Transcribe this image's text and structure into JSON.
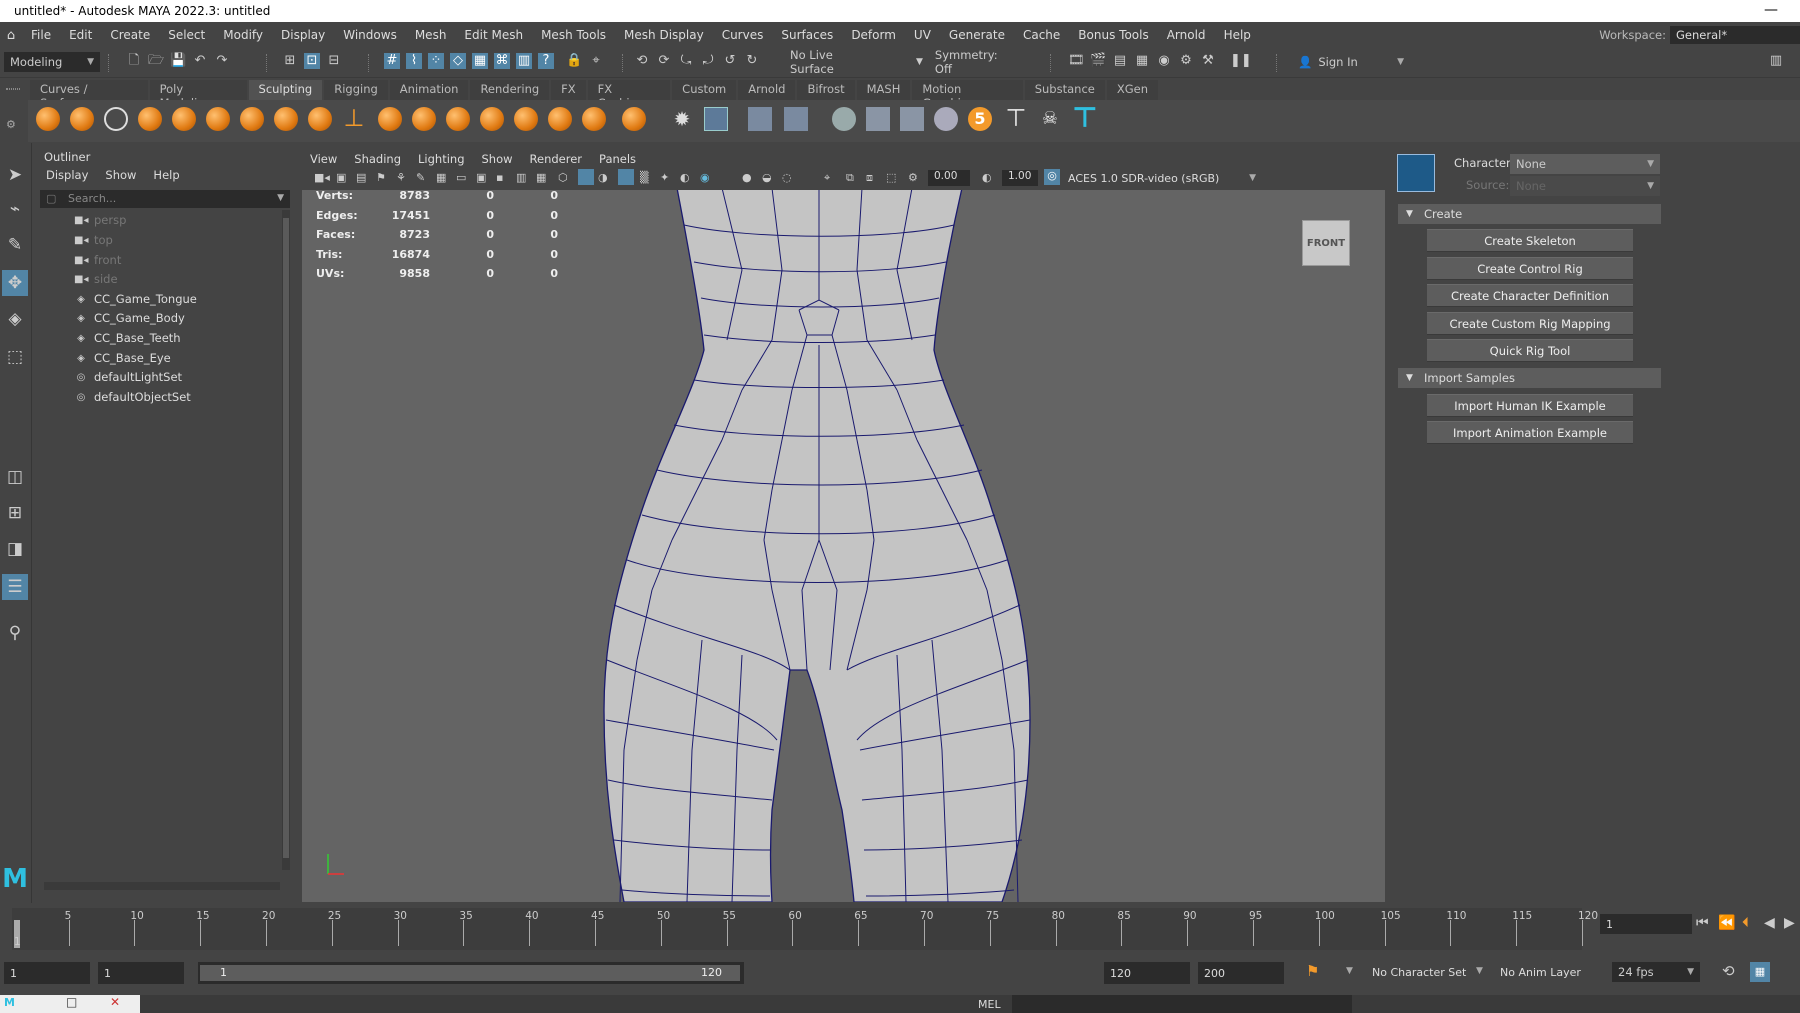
{
  "title": "untitled* - Autodesk MAYA 2022.3: untitled",
  "menu": [
    "File",
    "Edit",
    "Create",
    "Select",
    "Modify",
    "Display",
    "Windows",
    "Mesh",
    "Edit Mesh",
    "Mesh Tools",
    "Mesh Display",
    "Curves",
    "Surfaces",
    "Deform",
    "UV",
    "Generate",
    "Cache",
    "Bonus Tools",
    "Arnold",
    "Help"
  ],
  "workspace": {
    "label": "Workspace:",
    "value": "General*"
  },
  "statusline": {
    "mode": "Modeling",
    "live_surface": "No Live Surface",
    "symmetry": "Symmetry: Off",
    "sign_in": "Sign In"
  },
  "shelf_tabs": [
    "Curves / Surfaces",
    "Poly Modeling",
    "Sculpting",
    "Rigging",
    "Animation",
    "Rendering",
    "FX",
    "FX Caching",
    "Custom",
    "Arnold",
    "Bifrost",
    "MASH",
    "Motion Graphics",
    "Substance",
    "XGen"
  ],
  "shelf_active": "Sculpting",
  "outliner": {
    "title": "Outliner",
    "menu": [
      "Display",
      "Show",
      "Help"
    ],
    "search_placeholder": "Search...",
    "items": [
      {
        "label": "persp",
        "icon": "camera-icon",
        "dim": true
      },
      {
        "label": "top",
        "icon": "camera-icon",
        "dim": true
      },
      {
        "label": "front",
        "icon": "camera-icon",
        "dim": true
      },
      {
        "label": "side",
        "icon": "camera-icon",
        "dim": true
      },
      {
        "label": "CC_Game_Tongue",
        "icon": "mesh-icon",
        "dim": false
      },
      {
        "label": "CC_Game_Body",
        "icon": "mesh-icon",
        "dim": false
      },
      {
        "label": "CC_Base_Teeth",
        "icon": "mesh-icon",
        "dim": false
      },
      {
        "label": "CC_Base_Eye",
        "icon": "mesh-icon",
        "dim": false
      },
      {
        "label": "defaultLightSet",
        "icon": "set-icon",
        "dim": false
      },
      {
        "label": "defaultObjectSet",
        "icon": "set-icon",
        "dim": false
      }
    ]
  },
  "viewport": {
    "menu": [
      "View",
      "Shading",
      "Lighting",
      "Show",
      "Renderer",
      "Panels"
    ],
    "exposure": "0.00",
    "gamma": "1.00",
    "colorspace": "ACES 1.0 SDR-video (sRGB)",
    "view_cube": "FRONT",
    "hud": [
      {
        "label": "Verts:",
        "a": "8783",
        "b": "0",
        "c": "0"
      },
      {
        "label": "Edges:",
        "a": "17451",
        "b": "0",
        "c": "0"
      },
      {
        "label": "Faces:",
        "a": "8723",
        "b": "0",
        "c": "0"
      },
      {
        "label": "Tris:",
        "a": "16874",
        "b": "0",
        "c": "0"
      },
      {
        "label": "UVs:",
        "a": "9858",
        "b": "0",
        "c": "0"
      }
    ]
  },
  "hik": {
    "character_label": "Character:",
    "character_value": "None",
    "source_label": "Source:",
    "source_value": "None",
    "create_title": "Create",
    "create_buttons": [
      "Create Skeleton",
      "Create Control Rig",
      "Create Character Definition",
      "Create Custom Rig Mapping",
      "Quick Rig Tool"
    ],
    "import_title": "Import Samples",
    "import_buttons": [
      "Import Human IK Example",
      "Import Animation Example"
    ]
  },
  "timeline": {
    "labels": [
      "1",
      "5",
      "10",
      "15",
      "20",
      "25",
      "30",
      "35",
      "40",
      "45",
      "50",
      "55",
      "60",
      "65",
      "70",
      "75",
      "80",
      "85",
      "90",
      "95",
      "100",
      "105",
      "110",
      "115",
      "120"
    ],
    "current_frame": "1"
  },
  "range": {
    "start": "1",
    "playback_start": "1",
    "slider_start": "1",
    "slider_end": "120",
    "playback_end": "120",
    "end": "200",
    "char_set": "No Character Set",
    "anim_layer": "No Anim Layer",
    "fps": "24 fps"
  },
  "cmd": {
    "label": "MEL"
  },
  "colors": {
    "accent": "#5285a6",
    "mesh_wire": "#1a1a6e",
    "mesh_fill": "#c4c4c4",
    "viewport_bg": "#646464",
    "shelf_icon": "#f39a2b"
  }
}
